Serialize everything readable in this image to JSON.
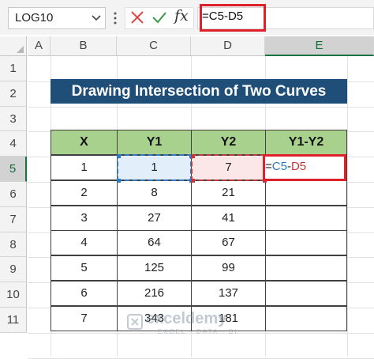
{
  "formula_bar": {
    "name_box": "LOG10",
    "formula_prefix": "=",
    "formula_ref1": "C5",
    "formula_op": "-",
    "formula_ref2": "D5"
  },
  "icons": {
    "name_box_dropdown": "chevron-down-icon",
    "cancel": "cancel-icon",
    "enter": "enter-icon",
    "insert_function": "fx-icon",
    "fx_label": "fx"
  },
  "columns": [
    "A",
    "B",
    "C",
    "D",
    "E"
  ],
  "rows": [
    "1",
    "2",
    "3",
    "4",
    "5",
    "6",
    "7",
    "8",
    "9",
    "10",
    "11"
  ],
  "title": "Drawing Intersection of Two Curves",
  "table": {
    "headers": [
      "X",
      "Y1",
      "Y2",
      "Y1-Y2"
    ],
    "rows": [
      [
        "1",
        "1",
        "7",
        ""
      ],
      [
        "2",
        "8",
        "21",
        ""
      ],
      [
        "3",
        "27",
        "41",
        ""
      ],
      [
        "4",
        "64",
        "67",
        ""
      ],
      [
        "5",
        "125",
        "99",
        ""
      ],
      [
        "6",
        "216",
        "137",
        ""
      ],
      [
        "7",
        "343",
        "181",
        ""
      ]
    ]
  },
  "editing_cell": {
    "prefix": "=",
    "ref1": "C5",
    "op": "-",
    "ref2": "D5"
  },
  "colors": {
    "ref1": "#2e79c7",
    "ref2": "#c43a3a",
    "title_bg": "#1f4e79",
    "header_bg": "#a9d18e",
    "highlight": "#e0202a"
  },
  "watermark": {
    "name": "exceldemy",
    "tagline": "EXCEL · DATA · BI"
  }
}
